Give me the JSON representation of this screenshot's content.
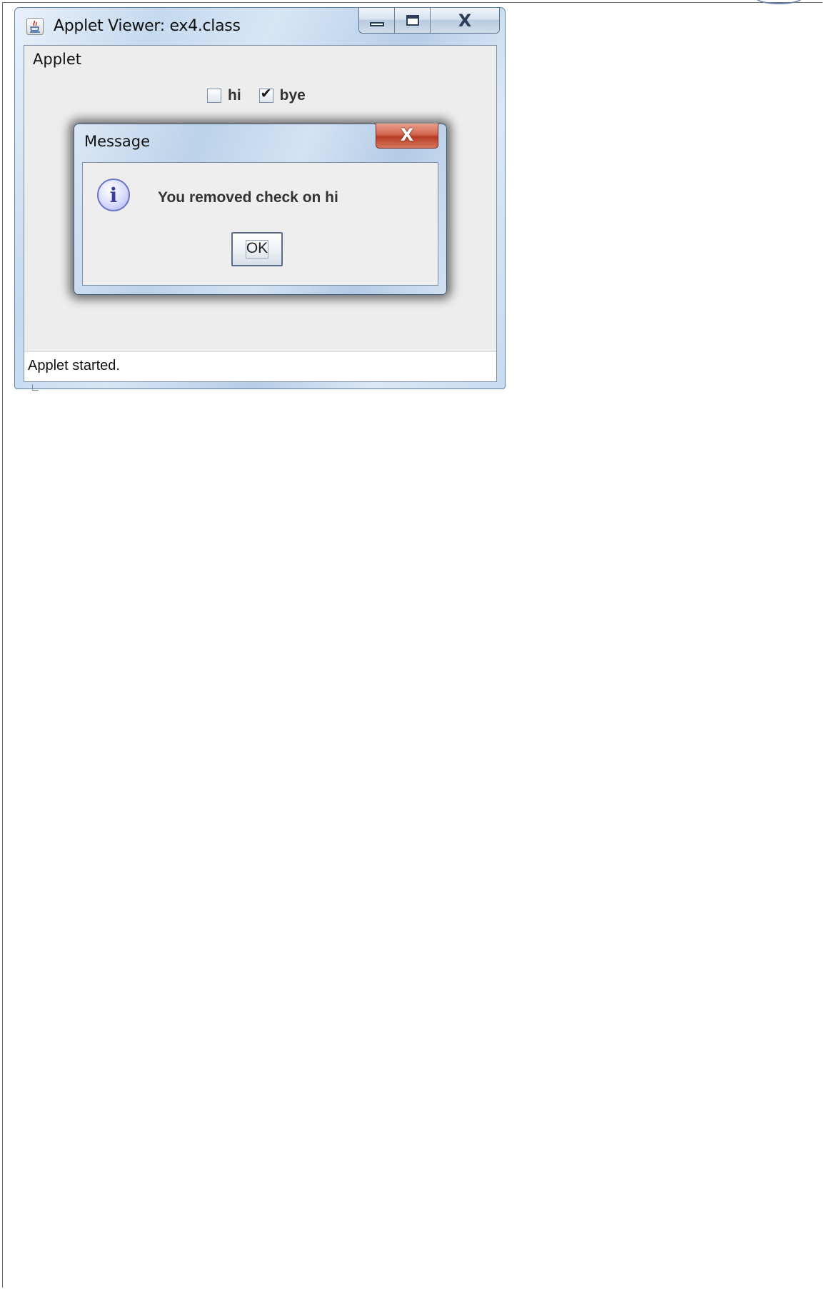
{
  "window": {
    "title": "Applet Viewer: ex4.class",
    "icon": "java-icon",
    "controls": {
      "minimize_icon": "minimize-icon",
      "maximize_icon": "maximize-icon",
      "close_label": "X"
    }
  },
  "applet": {
    "menu_label": "Applet",
    "checkboxes": [
      {
        "label": "hi",
        "checked": false,
        "mark": ""
      },
      {
        "label": "bye",
        "checked": true,
        "mark": "✔"
      }
    ],
    "status": "Applet started."
  },
  "dialog": {
    "title": "Message",
    "close_label": "X",
    "icon": "info-icon",
    "icon_glyph": "i",
    "message": "You removed check on hi",
    "ok_label": "OK"
  }
}
